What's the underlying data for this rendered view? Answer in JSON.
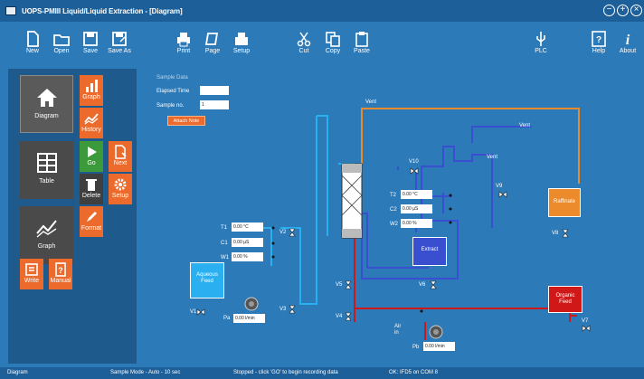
{
  "window": {
    "title": "UOPS-PMIII Liquid/Liquid Extraction - [Diagram]"
  },
  "toolbar": {
    "new": "New",
    "open": "Open",
    "save": "Save",
    "save_as": "Save As",
    "print": "Print",
    "page": "Page",
    "setup": "Setup",
    "cut": "Cut",
    "copy": "Copy",
    "paste": "Paste",
    "plc": "PLC",
    "help": "Help",
    "about": "About"
  },
  "sidebar": {
    "diagram": "Diagram",
    "graph_tile": "Graph",
    "table": "Table",
    "graph": "Graph",
    "history": "History",
    "go": "Go",
    "next": "Next",
    "delete": "Delete",
    "setup": "Setup",
    "format": "Format",
    "write": "Write",
    "manual": "Manual"
  },
  "sample": {
    "header": "Sample Data",
    "elapsed_label": "Elapsed Time",
    "elapsed_value": "",
    "sample_no_label": "Sample no.",
    "sample_no_value": "1",
    "attach_button": "Attach Note"
  },
  "diagram": {
    "vent_top": "Vent",
    "vent_right": "Vent",
    "vent_mid": "Vent",
    "t1_label": "T1",
    "t1_value": "0.00 °C",
    "c1_label": "C1",
    "c1_value": "0.00 µS",
    "w1_label": "W1",
    "w1_value": "0.00 %",
    "t2_label": "T2",
    "t2_value": "0.00 °C",
    "c2_label": "C2",
    "c2_value": "0.00 µS",
    "w2_label": "W2",
    "w2_value": "0.00 %",
    "v1": "V1",
    "v2": "V2",
    "v3": "V3",
    "v4": "V4",
    "v5": "V5",
    "v6": "V6",
    "v7": "V7",
    "v8": "V8",
    "v9": "V9",
    "v10": "V10",
    "pump_a_label": "Pa",
    "pump_a_value": "0.00 l/min",
    "pump_b_label": "Pb",
    "pump_b_value": "0.00 l/min",
    "air_label": "Air\nin",
    "aqueous_feed": "Aqueous\nFeed",
    "extract": "Extract",
    "raffinate": "Raffinate",
    "organic_feed": "Organic\nFeed"
  },
  "status": {
    "mode": "Diagram",
    "sample_mode": "Sample Mode - Auto - 10 sec",
    "stopped": "Stopped - click 'GO' to begin recording data",
    "comms": "OK: IFD5 on COM 8"
  },
  "colors": {
    "orange": "#ec6b2c",
    "blue_pipe": "#3a4fd0",
    "light_pipe": "#2ab0f0",
    "red_pipe": "#d01818",
    "orange_pipe": "#e88b2a"
  }
}
